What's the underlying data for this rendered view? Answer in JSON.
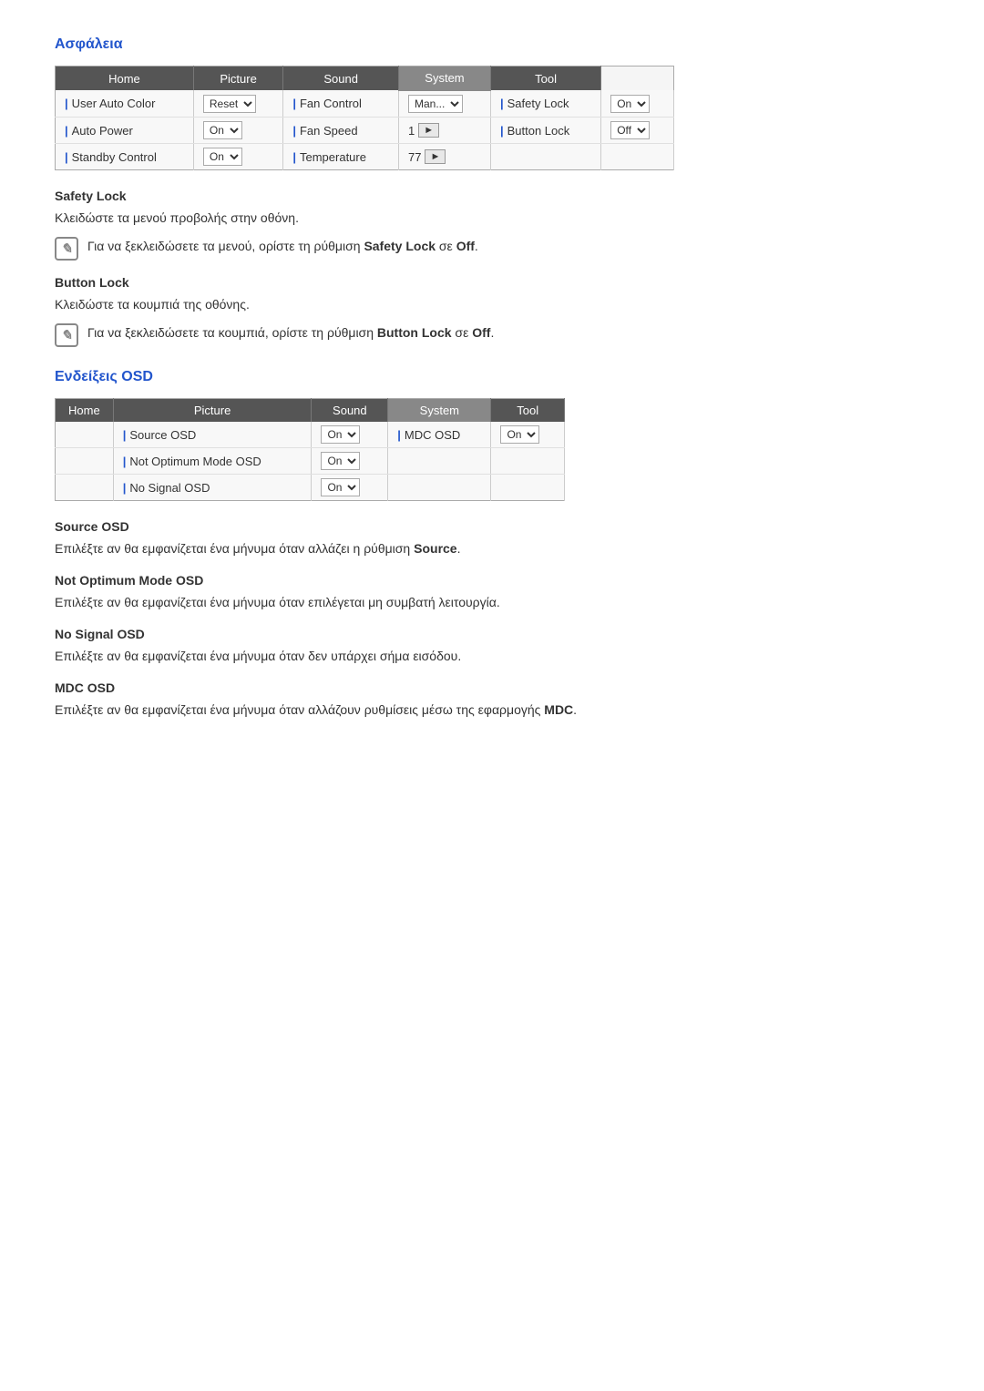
{
  "page": {
    "section1": {
      "title": "Ασφάλεια",
      "tabs": [
        "Home",
        "Picture",
        "Sound",
        "System",
        "Tool"
      ],
      "active_tab": "System",
      "rows": [
        {
          "col1_label": "User Auto Color",
          "col1_value": "Reset",
          "col1_type": "dropdown",
          "col2_label": "Fan Control",
          "col2_value": "Man...",
          "col2_type": "dropdown",
          "col3_label": "Safety Lock",
          "col3_value": "On",
          "col3_type": "dropdown"
        },
        {
          "col1_label": "Auto Power",
          "col1_value": "On",
          "col1_type": "dropdown",
          "col2_label": "Fan Speed",
          "col2_value": "1",
          "col2_type": "arrow",
          "col3_label": "Button Lock",
          "col3_value": "Off",
          "col3_type": "dropdown"
        },
        {
          "col1_label": "Standby Control",
          "col1_value": "On",
          "col1_type": "dropdown",
          "col2_label": "Temperature",
          "col2_value": "77",
          "col2_type": "arrow",
          "col3_label": "",
          "col3_value": "",
          "col3_type": "none"
        }
      ],
      "safety_lock": {
        "heading": "Safety Lock",
        "body": "Κλειδώστε τα μενού προβολής στην οθόνη.",
        "note": "Για να ξεκλειδώσετε τα μενού, ορίστε τη ρύθμιση Safety Lock σε Off.",
        "note_bold_part1": "Safety Lock",
        "note_bold_part2": "Off"
      },
      "button_lock": {
        "heading": "Button Lock",
        "body": "Κλειδώστε τα κουμπιά της οθόνης.",
        "note": "Για να ξεκλειδώσετε τα κουμπιά, ορίστε τη ρύθμιση Button Lock σε Off.",
        "note_bold_part1": "Button Lock",
        "note_bold_part2": "Off"
      }
    },
    "section2": {
      "title": "Ενδείξεις OSD",
      "tabs": [
        "Home",
        "Picture",
        "Sound",
        "System",
        "Tool"
      ],
      "active_tab": "System",
      "rows": [
        {
          "col1_label": "Source OSD",
          "col1_value": "On",
          "col1_type": "dropdown",
          "col2_label": "MDC OSD",
          "col2_value": "On",
          "col2_type": "dropdown"
        },
        {
          "col1_label": "Not Optimum Mode OSD",
          "col1_value": "On",
          "col1_type": "dropdown",
          "col2_label": "",
          "col2_value": "",
          "col2_type": "none"
        },
        {
          "col1_label": "No Signal OSD",
          "col1_value": "On",
          "col1_type": "dropdown",
          "col2_label": "",
          "col2_value": "",
          "col2_type": "none"
        }
      ],
      "source_osd": {
        "heading": "Source OSD",
        "body": "Επιλέξτε αν θα εμφανίζεται ένα μήνυμα όταν αλλάζει η ρύθμιση Source.",
        "bold_word": "Source"
      },
      "not_optimum_osd": {
        "heading": "Not Optimum Mode OSD",
        "body": "Επιλέξτε αν θα εμφανίζεται ένα μήνυμα όταν επιλέγεται μη συμβατή λειτουργία."
      },
      "no_signal_osd": {
        "heading": "No Signal OSD",
        "body": "Επιλέξτε αν θα εμφανίζεται ένα μήνυμα όταν δεν υπάρχει σήμα εισόδου."
      },
      "mdc_osd": {
        "heading": "MDC OSD",
        "body": "Επιλέξτε αν θα εμφανίζεται ένα μήνυμα όταν αλλάζουν ρυθμίσεις μέσω της εφαρμογής MDC.",
        "bold_word": "MDC"
      }
    }
  }
}
